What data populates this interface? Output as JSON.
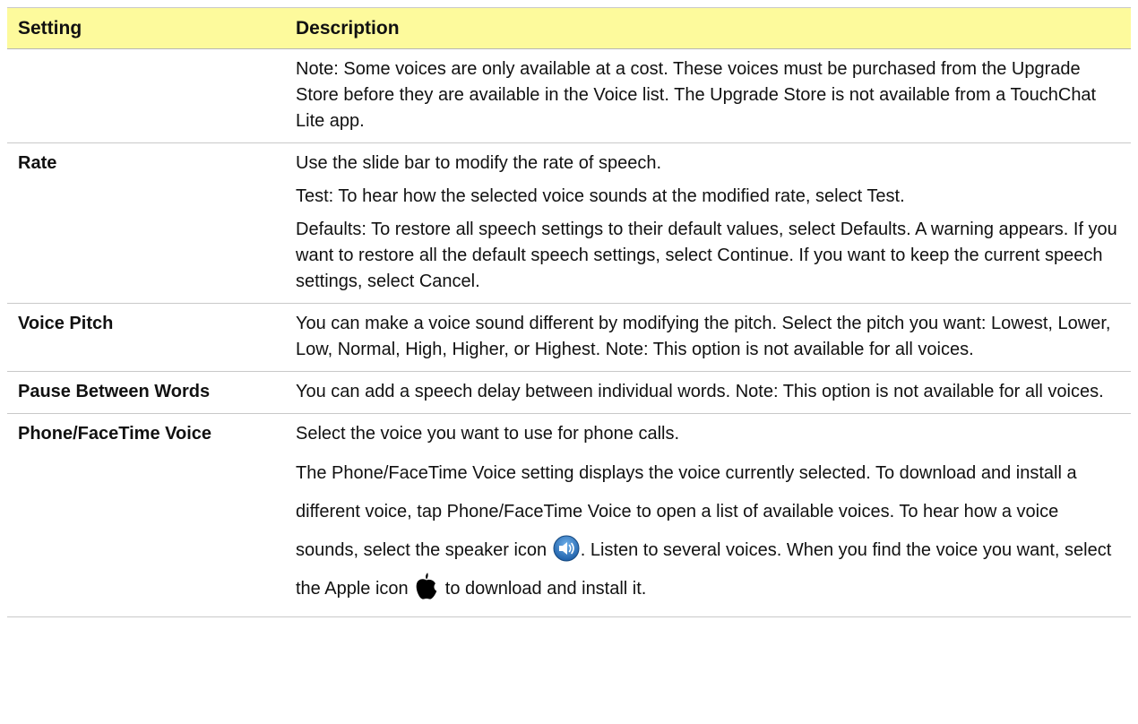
{
  "table": {
    "headers": {
      "setting": "Setting",
      "description": "Description"
    },
    "rows": [
      {
        "setting": "",
        "paragraphs": [
          "Note: Some voices are only available at a cost. These voices must be purchased from the Upgrade Store before they are available in the Voice list. The Upgrade Store is not available from a TouchChat Lite app."
        ]
      },
      {
        "setting": "Rate",
        "paragraphs": [
          "Use the slide bar to modify the rate of speech.",
          "Test: To hear how the selected voice sounds at the modified rate, select Test.",
          "Defaults: To restore all speech settings to their default values, select Defaults. A warning appears. If you want to restore all the default speech settings, select Continue. If you want to keep the current speech settings, select Cancel."
        ]
      },
      {
        "setting": "Voice Pitch",
        "paragraphs": [
          "You can make a voice sound different by modifying the pitch. Select the pitch you want: Lowest, Lower, Low, Normal, High, Higher, or Highest. Note: This option is not available for all voices."
        ]
      },
      {
        "setting": "Pause Between Words",
        "paragraphs": [
          "You can add a speech delay between individual words. Note: This option is not available for all voices."
        ]
      },
      {
        "setting": "Phone/FaceTime Voice",
        "paragraphs": [
          "Select the voice you want to use for phone calls."
        ],
        "rich": {
          "text_a": "The Phone/FaceTime Voice setting displays the voice currently selected. To download and install a different voice, tap Phone/FaceTime Voice to open a list of available voices. To hear how a voice sounds, select the speaker icon ",
          "icon_a": "speaker-icon",
          "text_b": ". Listen to several voices. When you find the voice you want, select the Apple icon ",
          "icon_b": "apple-icon",
          "text_c": " to download and install it."
        }
      }
    ]
  },
  "colors": {
    "header_bg": "#fdfa9c",
    "row_rule": "#c9c9c9",
    "speaker_icon_blue": "#2a6fb8"
  }
}
